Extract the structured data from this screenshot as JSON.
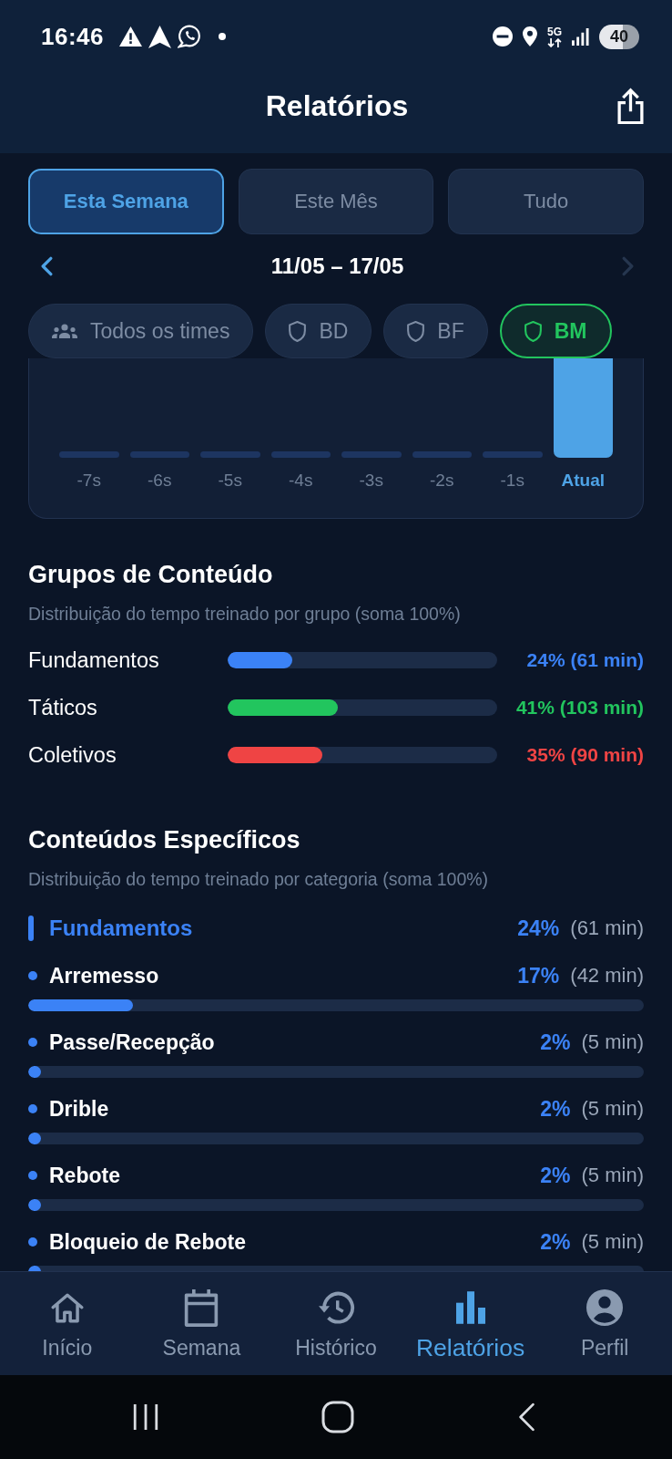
{
  "status_bar": {
    "time": "16:46",
    "network": "5G",
    "battery": "40"
  },
  "header": {
    "title": "Relatórios"
  },
  "period_tabs": [
    {
      "label": "Esta Semana",
      "selected": true
    },
    {
      "label": "Este Mês",
      "selected": false
    },
    {
      "label": "Tudo",
      "selected": false
    }
  ],
  "date_nav": {
    "label": "11/05 – 17/05",
    "prev_disabled": false,
    "next_disabled": true
  },
  "team_filters": [
    {
      "kind": "all",
      "label": "Todos os times",
      "selected": false
    },
    {
      "kind": "team",
      "label": "BD",
      "selected": false
    },
    {
      "kind": "team",
      "label": "BF",
      "selected": false
    },
    {
      "kind": "team",
      "label": "BM",
      "selected": true
    }
  ],
  "weekly_chart": {
    "bars": [
      {
        "label": "-7s",
        "current": false
      },
      {
        "label": "-6s",
        "current": false
      },
      {
        "label": "-5s",
        "current": false
      },
      {
        "label": "-4s",
        "current": false
      },
      {
        "label": "-3s",
        "current": false
      },
      {
        "label": "-2s",
        "current": false
      },
      {
        "label": "-1s",
        "current": false
      },
      {
        "label": "Atual",
        "current": true
      }
    ]
  },
  "content_groups": {
    "title": "Grupos de Conteúdo",
    "subtitle": "Distribuição do tempo treinado por grupo (soma 100%)",
    "rows": [
      {
        "name": "Fundamentos",
        "level": 0.24,
        "reading": "24% (61 min)",
        "color": "#3b82f6"
      },
      {
        "name": "Táticos",
        "level": 0.41,
        "reading": "41% (103 min)",
        "color": "#22c55e"
      },
      {
        "name": "Coletivos",
        "level": 0.35,
        "reading": "35% (90 min)",
        "color": "#ef4444"
      }
    ]
  },
  "specific_contents": {
    "title": "Conteúdos Específicos",
    "subtitle": "Distribuição do tempo treinado por categoria (soma 100%)",
    "groups": [
      {
        "name": "Fundamentos",
        "color": "#3b82f6",
        "percent": "24%",
        "minutes": "(61 min)",
        "items": [
          {
            "name": "Arremesso",
            "percent": "17%",
            "minutes": "(42 min)",
            "level": 0.17
          },
          {
            "name": "Passe/Recepção",
            "percent": "2%",
            "minutes": "(5 min)",
            "level": 0.02
          },
          {
            "name": "Drible",
            "percent": "2%",
            "minutes": "(5 min)",
            "level": 0.02
          },
          {
            "name": "Rebote",
            "percent": "2%",
            "minutes": "(5 min)",
            "level": 0.02
          },
          {
            "name": "Bloqueio de Rebote",
            "percent": "2%",
            "minutes": "(5 min)",
            "level": 0.02
          }
        ]
      }
    ]
  },
  "bottom_nav": [
    {
      "label": "Início",
      "selected": false
    },
    {
      "label": "Semana",
      "selected": false
    },
    {
      "label": "Histórico",
      "selected": false
    },
    {
      "label": "Relatórios",
      "selected": true
    },
    {
      "label": "Perfil",
      "selected": false
    }
  ]
}
